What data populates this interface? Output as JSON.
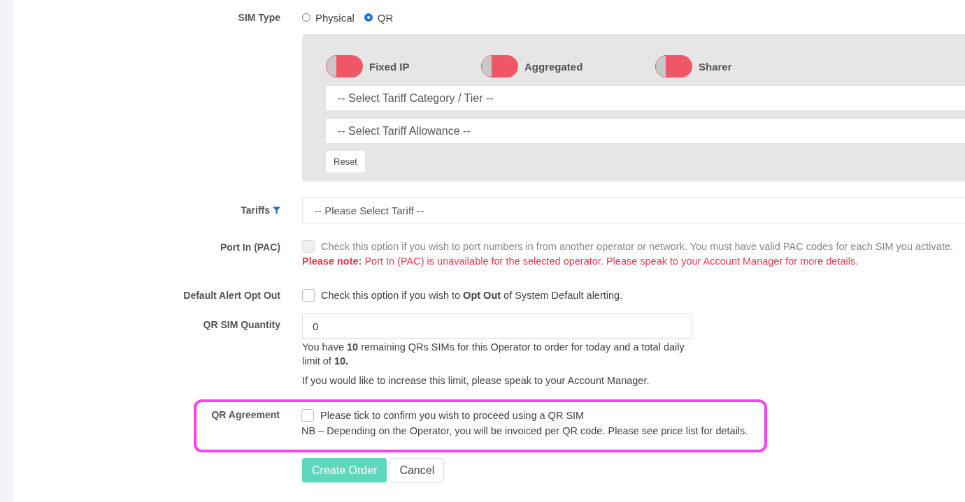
{
  "sim_type": {
    "label": "SIM Type",
    "options": [
      {
        "label": "Physical",
        "selected": false
      },
      {
        "label": "QR",
        "selected": true
      }
    ]
  },
  "filters": {
    "toggles": [
      {
        "label": "Fixed IP",
        "on": false
      },
      {
        "label": "Aggregated",
        "on": false
      },
      {
        "label": "Sharer",
        "on": false
      }
    ],
    "category_select": {
      "placeholder": "-- Select Tariff Category / Tier --"
    },
    "allowance_select": {
      "placeholder": "-- Select Tariff Allowance --"
    },
    "reset_button": "Reset"
  },
  "tariffs": {
    "label": "Tariffs",
    "placeholder": "-- Please Select Tariff --"
  },
  "port_in": {
    "label": "Port In (PAC)",
    "checked": false,
    "disabled": true,
    "text": "Check this option if you wish to port numbers in from another operator or network. You must have valid PAC codes for each SIM you activate.",
    "note": "**Please note:** Port In (PAC) is unavailable for the selected operator. Please speak to your Account Manager for more details."
  },
  "default_alert": {
    "label": "Default Alert Opt Out",
    "checked": false,
    "disabled": false,
    "text": "Check this option if you wish to **Opt Out** of System Default alerting."
  },
  "qr_quantity": {
    "label": "QR SIM Quantity",
    "value": "0",
    "help": "You have **10** remaining QRs SIMs for this Operator to order for today and a total daily limit of **10.**",
    "limit_note": "If you would like to increase this limit, please speak to your Account Manager."
  },
  "qr_agreement": {
    "label": "QR Agreement",
    "checked": false,
    "text": "Please tick to confirm you wish to proceed using a QR SIM",
    "note": "NB – Depending on the Operator, you will be invoiced per QR code. Please see price list for details."
  },
  "buttons": [
    {
      "label": "Create Order",
      "kind": "primary"
    },
    {
      "label": "Cancel",
      "kind": "default"
    }
  ]
}
